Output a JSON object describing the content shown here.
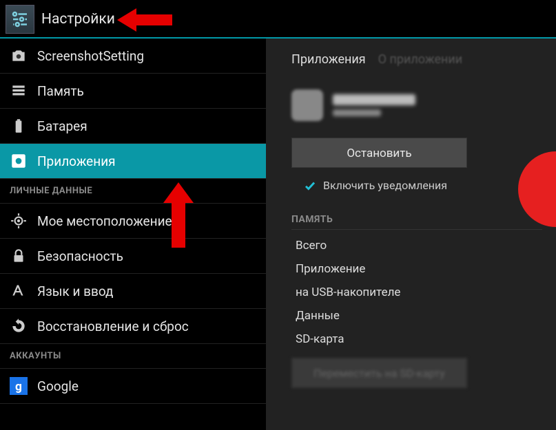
{
  "header": {
    "title": "Настройки"
  },
  "sidebar": {
    "items": [
      {
        "label": "ScreenshotSetting",
        "icon": "camera-icon"
      },
      {
        "label": "Память",
        "icon": "storage-icon"
      },
      {
        "label": "Батарея",
        "icon": "battery-icon"
      },
      {
        "label": "Приложения",
        "icon": "apps-icon",
        "selected": true
      }
    ],
    "section_personal": "ЛИЧНЫЕ ДАННЫЕ",
    "personal_items": [
      {
        "label": "Мое местоположение",
        "icon": "location-icon"
      },
      {
        "label": "Безопасность",
        "icon": "lock-icon"
      },
      {
        "label": "Язык и ввод",
        "icon": "language-icon"
      },
      {
        "label": "Восстановление и сброс",
        "icon": "reset-icon"
      }
    ],
    "section_accounts": "АККАУНТЫ",
    "account_items": [
      {
        "label": "Google",
        "icon": "google-icon"
      }
    ]
  },
  "detail": {
    "tab_active": "Приложения",
    "tab_inactive": "О приложении",
    "stop_button": "Остановить",
    "notif_check_label": "Включить уведомления",
    "memory_section": "ПАМЯТЬ",
    "rows": [
      "Всего",
      "Приложение",
      "на USB-накопителе",
      "Данные",
      "SD-карта"
    ],
    "move_button": "Переместить на SD-карту"
  },
  "annotation_colors": {
    "arrow": "#e60000",
    "circle": "#e62020"
  }
}
